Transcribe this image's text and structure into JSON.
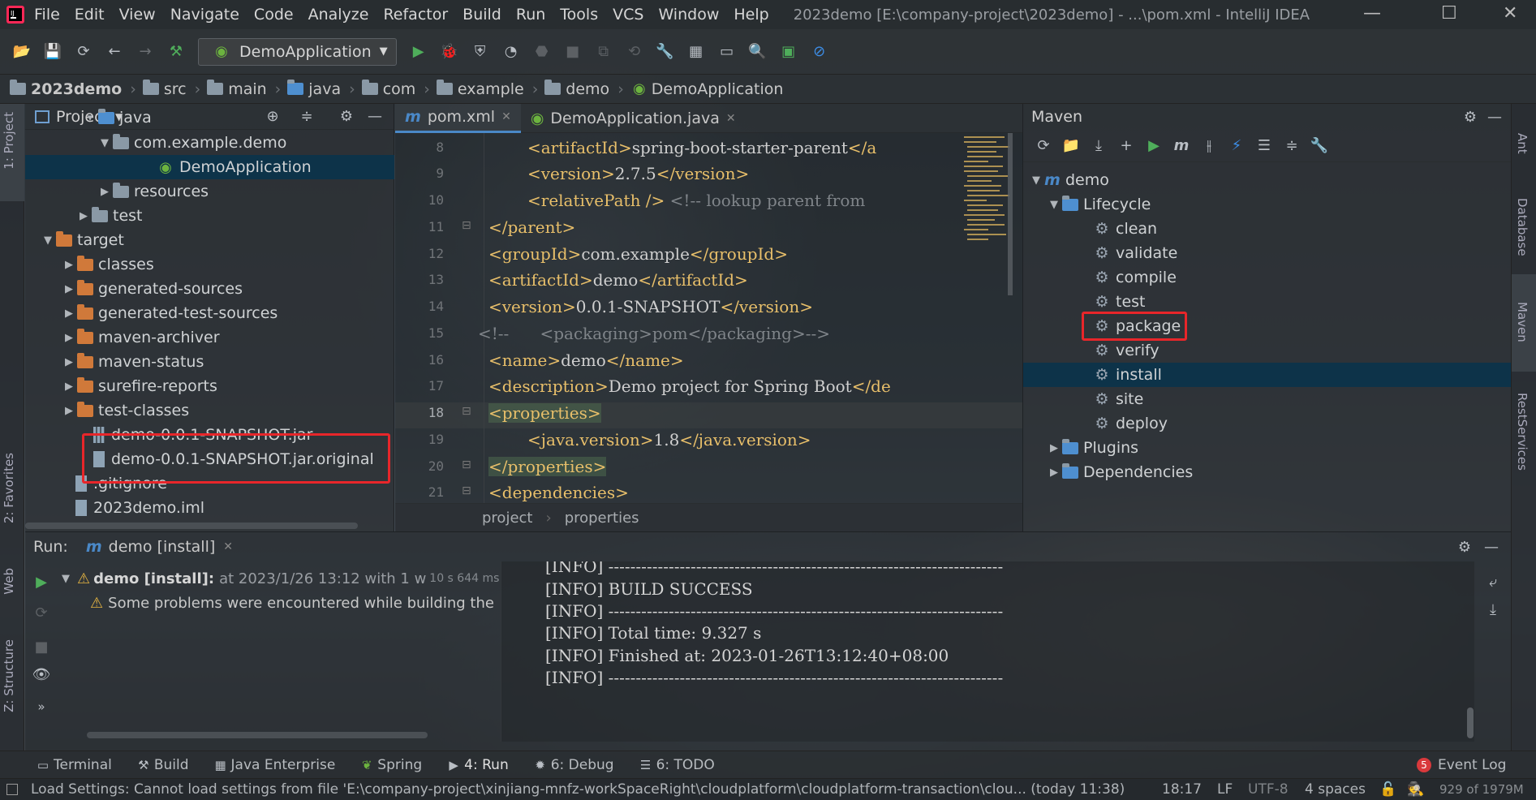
{
  "menu": {
    "items": [
      "File",
      "Edit",
      "View",
      "Navigate",
      "Code",
      "Analyze",
      "Refactor",
      "Build",
      "Run",
      "Tools",
      "VCS",
      "Window",
      "Help"
    ],
    "window_title": "2023demo [E:\\company-project\\2023demo] - ...\\pom.xml - IntelliJ IDEA"
  },
  "toolbar": {
    "run_config": "DemoApplication"
  },
  "breadcrumb": [
    "2023demo",
    "src",
    "main",
    "java",
    "com",
    "example",
    "demo",
    "DemoApplication"
  ],
  "project": {
    "title": "Project",
    "rows": [
      {
        "label": "java"
      },
      {
        "label": "com.example.demo"
      },
      {
        "label": "DemoApplication"
      },
      {
        "label": "resources"
      },
      {
        "label": "test"
      },
      {
        "label": "target"
      },
      {
        "label": "classes"
      },
      {
        "label": "generated-sources"
      },
      {
        "label": "generated-test-sources"
      },
      {
        "label": "maven-archiver"
      },
      {
        "label": "maven-status"
      },
      {
        "label": "surefire-reports"
      },
      {
        "label": "test-classes"
      },
      {
        "label": "demo-0.0.1-SNAPSHOT.jar"
      },
      {
        "label": "demo-0.0.1-SNAPSHOT.jar.original"
      },
      {
        "label": ".gitignore"
      },
      {
        "label": "2023demo.iml"
      }
    ]
  },
  "editor": {
    "tabs": [
      "pom.xml",
      "DemoApplication.java"
    ],
    "line_numbers": [
      "8",
      "9",
      "10",
      "11",
      "12",
      "13",
      "14",
      "15",
      "16",
      "17",
      "18",
      "19",
      "20",
      "21"
    ],
    "breadcrumb": [
      "project",
      "properties"
    ]
  },
  "maven": {
    "title": "Maven",
    "root": "demo",
    "lifecycle_label": "Lifecycle",
    "lifecycle": [
      "clean",
      "validate",
      "compile",
      "test",
      "package",
      "verify",
      "install",
      "site",
      "deploy"
    ],
    "plugins_label": "Plugins",
    "dependencies_label": "Dependencies"
  },
  "run": {
    "label": "Run:",
    "tab": "demo [install]",
    "tree_title": "demo [install]:",
    "tree_detail": "at 2023/1/26 13:12 with 1 w",
    "tree_time": "10 s 644 ms",
    "warning": "Some problems were encountered while building the",
    "console": [
      "[INFO] ------------------------------------------------------------------------",
      "[INFO] BUILD SUCCESS",
      "[INFO] ------------------------------------------------------------------------",
      "[INFO] Total time:  9.327 s",
      "[INFO] Finished at: 2023-01-26T13:12:40+08:00",
      "[INFO] ------------------------------------------------------------------------"
    ]
  },
  "left_stripe": [
    "1: Project",
    "2: Favorites",
    "Web",
    "Z: Structure"
  ],
  "right_stripe": [
    "Ant",
    "Database",
    "Maven",
    "RestServices"
  ],
  "tool_tabs": [
    "Terminal",
    "Build",
    "Java Enterprise",
    "Spring",
    "4: Run",
    "6: Debug",
    "6: TODO"
  ],
  "event_log": {
    "badge": "5",
    "label": "Event Log"
  },
  "status": {
    "message": "Load Settings: Cannot load settings from file 'E:\\company-project\\xinjiang-mnfz-workSpaceRight\\cloudplatform\\cloudplatform-transaction\\clou... (today 11:38)",
    "position": "18:17",
    "line_sep": "LF",
    "encoding": "UTF-8",
    "indent": "4 spaces",
    "memory": "929 of 1979M"
  },
  "colors": {
    "accent": "#4a88c7",
    "highlight": "#e8262a",
    "selection": "#0d3349",
    "xml_tag": "#e8bf6a"
  }
}
